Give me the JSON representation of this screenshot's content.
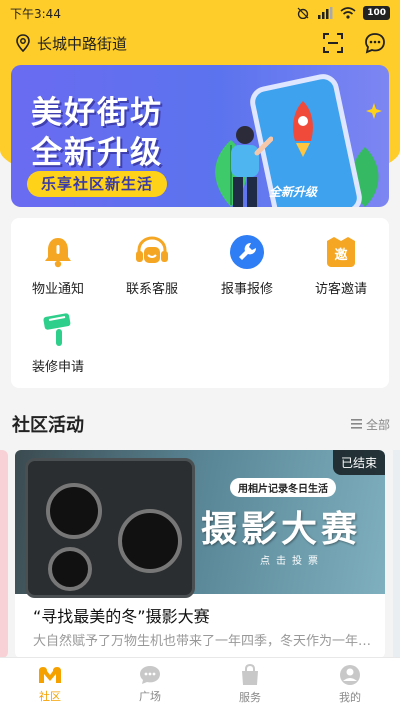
{
  "status": {
    "time": "下午3:44",
    "battery": "100"
  },
  "header": {
    "location": "长城中路街道"
  },
  "banner": {
    "line1": "美好街坊",
    "line2": "全新升级",
    "tagline": "乐享社区新生活",
    "phone_caption": "全新升级"
  },
  "services": [
    {
      "label": "物业通知",
      "icon": "bell-icon",
      "color": "#f5a623"
    },
    {
      "label": "联系客服",
      "icon": "headset-icon",
      "color": "#f5a623"
    },
    {
      "label": "报事报修",
      "icon": "wrench-icon",
      "color": "#2f7ef5"
    },
    {
      "label": "访客邀请",
      "icon": "invite-icon",
      "color": "#f5a623"
    },
    {
      "label": "装修申请",
      "icon": "paint-brush-icon",
      "color": "#2ecf8a"
    }
  ],
  "section": {
    "title": "社区活动",
    "more": "全部"
  },
  "activity": {
    "badge": "已结束",
    "pill": "用相片记录冬日生活",
    "big_title": "摄影大赛",
    "sub": "点击投票",
    "title": "“寻找最美的冬”摄影大赛",
    "desc": "大自然赋予了万物生机也带来了一年四季，冬天作为一年中..."
  },
  "tabs": [
    {
      "label": "社区",
      "icon": "community-icon",
      "active": true
    },
    {
      "label": "广场",
      "icon": "chat-icon",
      "active": false
    },
    {
      "label": "服务",
      "icon": "bag-icon",
      "active": false
    },
    {
      "label": "我的",
      "icon": "profile-icon",
      "active": false
    }
  ],
  "colors": {
    "brand_yellow": "#ffcd29",
    "banner_blue": "#5b73ee",
    "active_tab": "#f5a200"
  }
}
